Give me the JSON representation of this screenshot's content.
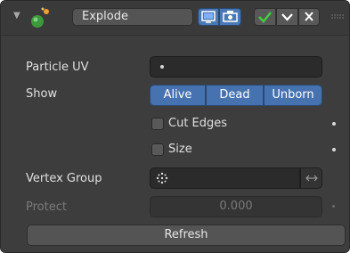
{
  "modifier": {
    "name": "Explode",
    "icon": "particle-modifier-icon",
    "buttons": [
      "show-in-editmode-icon",
      "show-in-render-icon",
      "apply-check-icon",
      "dropdown-chevron-icon",
      "remove-x-icon"
    ]
  },
  "fields": {
    "particle_uv_label": "Particle UV",
    "show_label": "Show",
    "show_options": [
      "Alive",
      "Dead",
      "Unborn"
    ],
    "cut_edges_label": "Cut Edges",
    "size_label": "Size",
    "vertex_group_label": "Vertex Group",
    "protect_label": "Protect",
    "protect_value": "0.000"
  },
  "actions": {
    "refresh_label": "Refresh"
  },
  "colors": {
    "accent": "#4672b0",
    "panel": "#3d3d3d",
    "field": "#2b2b2b"
  }
}
